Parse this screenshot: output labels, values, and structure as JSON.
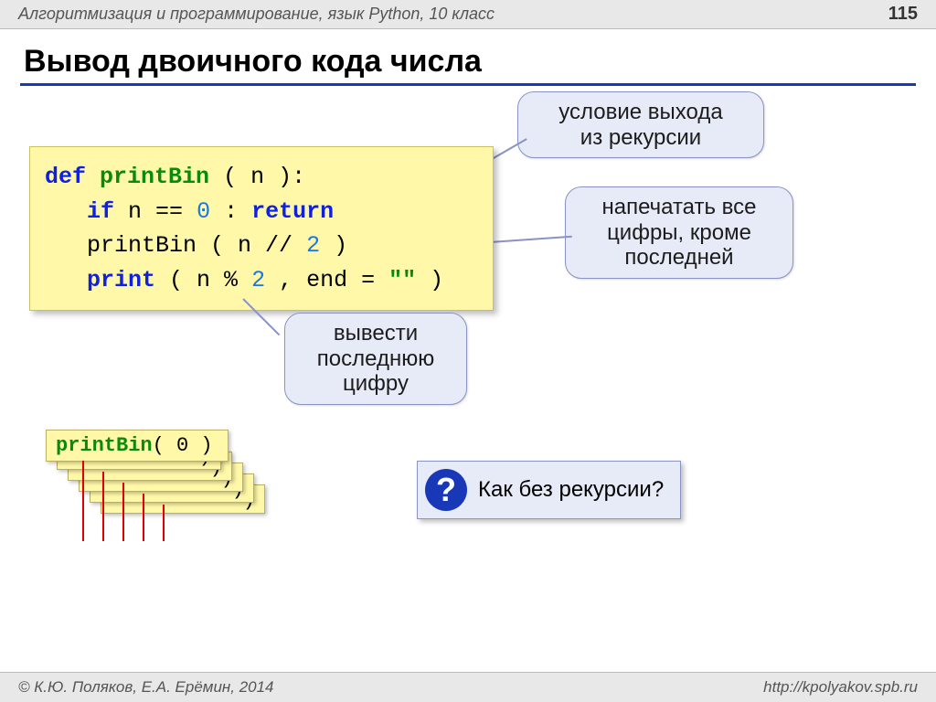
{
  "header": {
    "subject": "Алгоритмизация и программирование, язык Python, 10 класс",
    "page": "115"
  },
  "title": "Вывод двоичного кода числа",
  "code": {
    "l1a": "def",
    "l1b": "printBin",
    "l1c": " ( n ):",
    "l2a": "if",
    "l2b": " n ==",
    "l2c": "0",
    "l2d": ":",
    "l2e": "return",
    "l3a": "printBin ( n //",
    "l3b": "2",
    "l3c": " )",
    "l4a": "print",
    "l4b": " ( n %",
    "l4c": "2",
    "l4d": ", end =",
    "l4e": "\"\"",
    "l4f": " )"
  },
  "callout1_a": "условие выхода",
  "callout1_b": "из рекурсии",
  "callout2_a": "напечатать все",
  "callout2_b": "цифры, кроме",
  "callout2_c": "последней",
  "callout3_a": "вывести",
  "callout3_b": "последнюю",
  "callout3_c": "цифру",
  "stack_top_a": "printBin",
  "stack_top_b": "( 0 )",
  "stack_tail": ")",
  "question": "Как без рекурсии?",
  "qmark": "?",
  "footer": {
    "left": "© К.Ю. Поляков, Е.А. Ерёмин, 2014",
    "right": "http://kpolyakov.spb.ru"
  }
}
